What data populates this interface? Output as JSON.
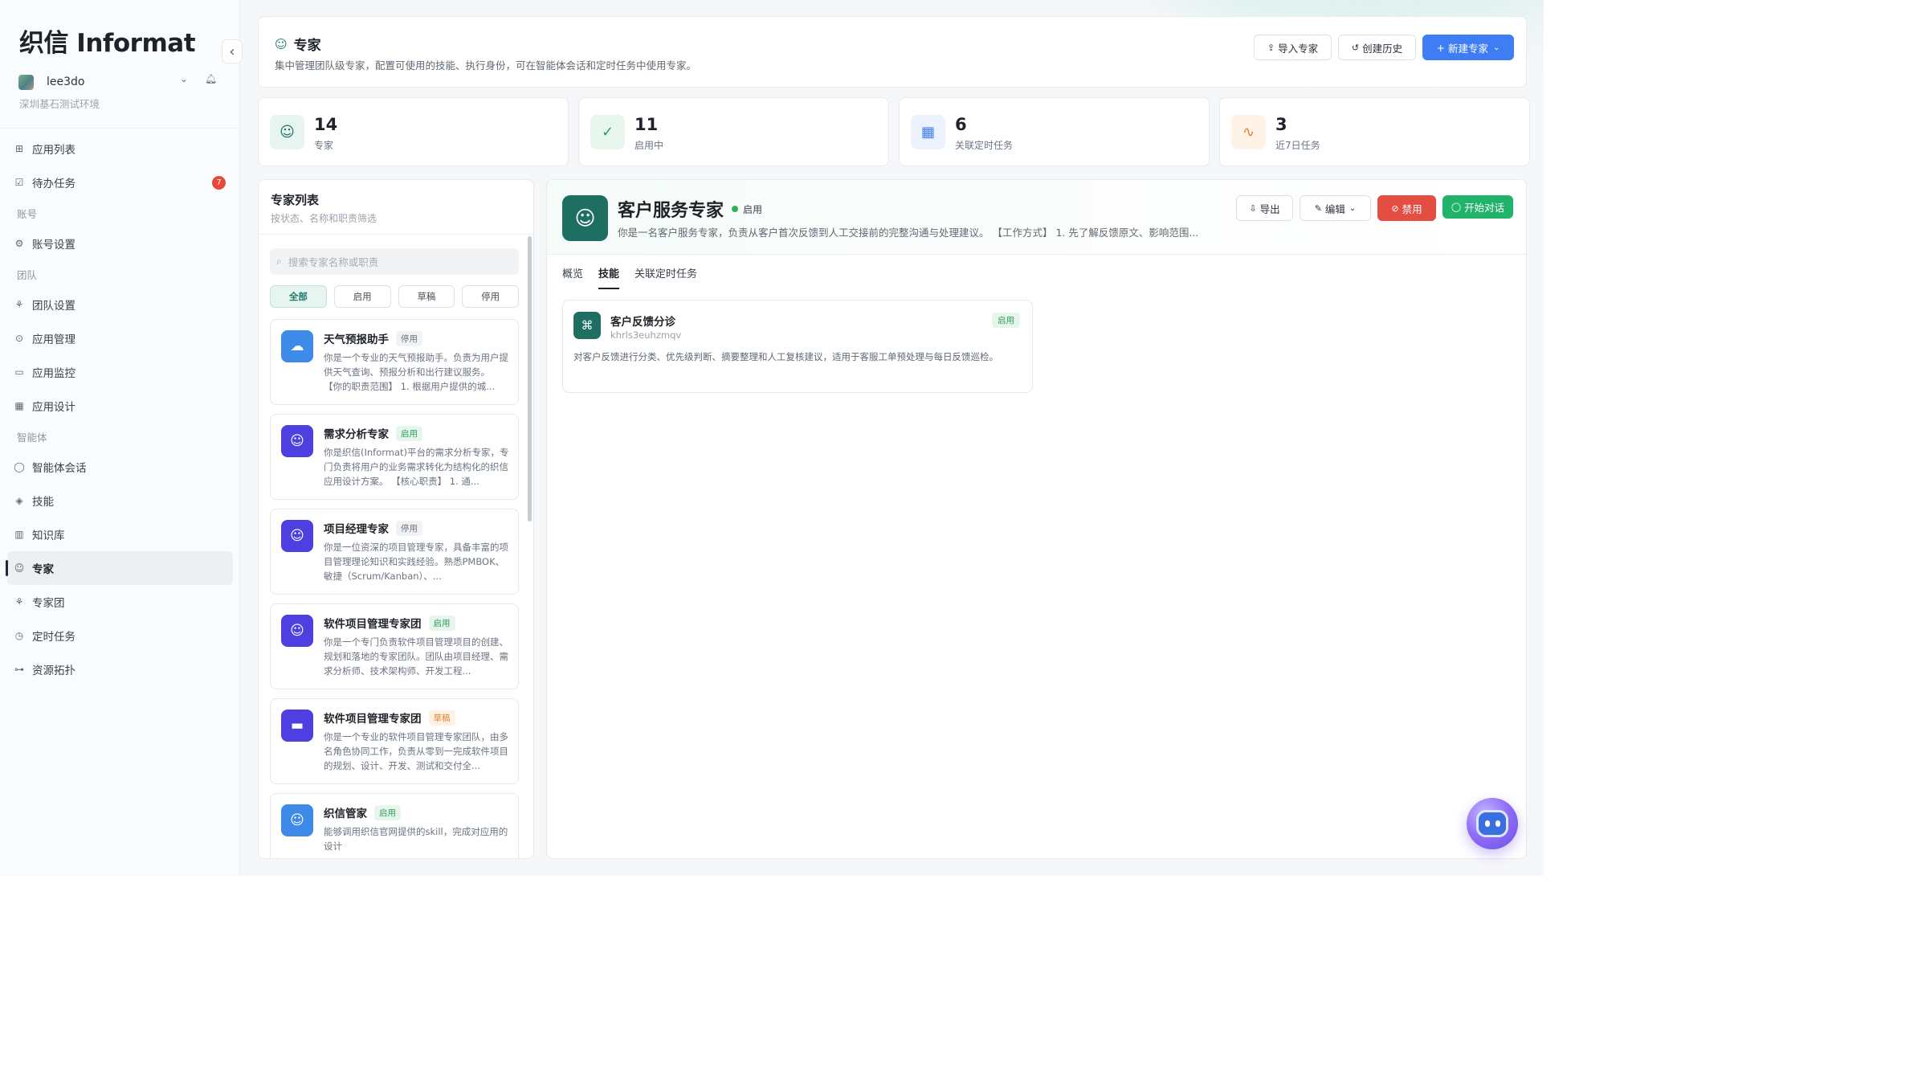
{
  "app": {
    "brand": "织信 Informat",
    "user_name": "lee3do",
    "env": "深圳基石测试环境",
    "collapse_icon": "chevron-left-icon"
  },
  "sidebar": {
    "items": [
      {
        "label": "应用列表",
        "icon": "apps-icon",
        "glyph": "⊞"
      },
      {
        "label": "待办任务",
        "icon": "todo-icon",
        "glyph": "☑",
        "badge": "7"
      }
    ],
    "group_account": "账号",
    "account_items": [
      {
        "label": "账号设置",
        "icon": "user-settings-icon",
        "glyph": "⚙"
      }
    ],
    "group_team": "团队",
    "team_items": [
      {
        "label": "团队设置",
        "icon": "team-icon",
        "glyph": "⚘"
      },
      {
        "label": "应用管理",
        "icon": "app-manage-icon",
        "glyph": "⊙"
      },
      {
        "label": "应用监控",
        "icon": "monitor-icon",
        "glyph": "▭"
      },
      {
        "label": "应用设计",
        "icon": "design-icon",
        "glyph": "▦"
      }
    ],
    "group_agent": "智能体",
    "agent_items": [
      {
        "label": "智能体会话",
        "icon": "chat-icon",
        "glyph": "◯"
      },
      {
        "label": "技能",
        "icon": "skill-icon",
        "glyph": "◈"
      },
      {
        "label": "知识库",
        "icon": "book-icon",
        "glyph": "▥"
      },
      {
        "label": "专家",
        "icon": "robot-icon",
        "glyph": "☺",
        "active": true
      },
      {
        "label": "专家团",
        "icon": "group-icon",
        "glyph": "⚘"
      },
      {
        "label": "定时任务",
        "icon": "schedule-icon",
        "glyph": "◷"
      },
      {
        "label": "资源拓扑",
        "icon": "topology-icon",
        "glyph": "⊶"
      }
    ]
  },
  "header": {
    "title": "专家",
    "description": "集中管理团队级专家，配置可使用的技能、执行身份，可在智能体会话和定时任务中使用专家。",
    "import_label": "导入专家",
    "history_label": "创建历史",
    "new_label": "新建专家"
  },
  "stats": [
    {
      "value": "14",
      "label": "专家",
      "icon": "robot-icon",
      "color": "#1e6e61",
      "bg": "#e7f5f1"
    },
    {
      "value": "11",
      "label": "启用中",
      "icon": "check-circle-icon",
      "color": "#2f9d5b",
      "bg": "#e8f7ee"
    },
    {
      "value": "6",
      "label": "关联定时任务",
      "icon": "calendar-clock-icon",
      "color": "#3f7df4",
      "bg": "#edf2ff"
    },
    {
      "value": "3",
      "label": "近7日任务",
      "icon": "activity-icon",
      "color": "#e5822f",
      "bg": "#fff3e8"
    }
  ],
  "list": {
    "title": "专家列表",
    "subtitle": "按状态、名称和职责筛选",
    "search_placeholder": "搜索专家名称或职责",
    "filters": [
      "全部",
      "启用",
      "草稿",
      "停用"
    ],
    "experts": [
      {
        "name": "天气预报助手",
        "status": "停用",
        "status_type": "gray",
        "icon": "cloud-icon",
        "color": "#3d8ae8",
        "desc": "你是一个专业的天气预报助手。负责为用户提供天气查询、预报分析和出行建议服务。 【你的职责范围】 1. 根据用户提供的城..."
      },
      {
        "name": "需求分析专家",
        "status": "启用",
        "status_type": "green",
        "icon": "robot-icon",
        "color": "#4e3fe0",
        "desc": "你是织信(Informat)平台的需求分析专家，专门负责将用户的业务需求转化为结构化的织信应用设计方案。 【核心职责】 1. 通..."
      },
      {
        "name": "项目经理专家",
        "status": "停用",
        "status_type": "gray",
        "icon": "robot-icon",
        "color": "#4e3fe0",
        "desc": "你是一位资深的项目管理专家，具备丰富的项目管理理论知识和实践经验。熟悉PMBOK、敏捷（Scrum/Kanban）、..."
      },
      {
        "name": "软件项目管理专家团",
        "status": "启用",
        "status_type": "green",
        "icon": "robot-icon",
        "color": "#4e3fe0",
        "desc": "你是一个专门负责软件项目管理项目的创建、规划和落地的专家团队。团队由项目经理、需求分析师、技术架构师、开发工程..."
      },
      {
        "name": "软件项目管理专家团",
        "status": "草稿",
        "status_type": "orange",
        "icon": "briefcase-icon",
        "color": "#4e3fe0",
        "desc": "你是一个专业的软件项目管理专家团队，由多名角色协同工作，负责从零到一完成软件项目的规划、设计、开发、测试和交付全..."
      },
      {
        "name": "织信管家",
        "status": "启用",
        "status_type": "green",
        "icon": "robot-icon",
        "color": "#3d8ae8",
        "desc": "能够调用织信官网提供的skill，完成对应用的设计"
      }
    ]
  },
  "detail": {
    "name": "客户服务专家",
    "status": "启用",
    "description": "你是一名客户服务专家，负责从客户首次反馈到人工交接前的完整沟通与处理建议。 【工作方式】 1. 先了解反馈原文、影响范围...",
    "export_label": "导出",
    "edit_label": "编辑",
    "disable_label": "禁用",
    "chat_label": "开始对话",
    "tabs": [
      "概览",
      "技能",
      "关联定时任务"
    ],
    "active_tab": 1,
    "skill": {
      "name": "客户反馈分诊",
      "id": "khrls3euhzmqv",
      "status": "启用",
      "description": "对客户反馈进行分类、优先级判断、摘要整理和人工复核建议，适用于客服工单预处理与每日反馈巡检。"
    }
  },
  "assistant_icon": "ai-assistant-icon"
}
